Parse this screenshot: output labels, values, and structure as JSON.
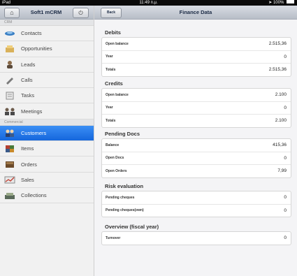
{
  "status": {
    "device": "iPad",
    "time": "11:49 п.μ.",
    "battery": "100%"
  },
  "sidebar": {
    "title": "Soft1 mCRM",
    "home_icon": "home-icon",
    "power_icon": "power-icon",
    "sections": [
      {
        "label": "CRM",
        "items": [
          {
            "label": "Contacts",
            "icon": "contacts-icon"
          },
          {
            "label": "Opportunities",
            "icon": "opportunities-icon"
          },
          {
            "label": "Leads",
            "icon": "leads-icon"
          },
          {
            "label": "Calls",
            "icon": "calls-icon"
          },
          {
            "label": "Tasks",
            "icon": "tasks-icon"
          },
          {
            "label": "Meetings",
            "icon": "meetings-icon"
          }
        ]
      },
      {
        "label": "Commercial",
        "items": [
          {
            "label": "Customers",
            "icon": "customers-icon",
            "active": true
          },
          {
            "label": "Items",
            "icon": "items-icon"
          },
          {
            "label": "Orders",
            "icon": "orders-icon"
          },
          {
            "label": "Sales",
            "icon": "sales-icon"
          },
          {
            "label": "Collections",
            "icon": "collections-icon"
          }
        ]
      }
    ]
  },
  "header": {
    "back_label": "Back",
    "title": "Finance Data"
  },
  "groups": [
    {
      "title": "Debits",
      "rows": [
        {
          "label": "Open balance",
          "value": "2.515,36"
        },
        {
          "label": "Year",
          "value": "0"
        },
        {
          "label": "Totals",
          "value": "2.515,36"
        }
      ]
    },
    {
      "title": "Credits",
      "rows": [
        {
          "label": "Open balance",
          "value": "2.100"
        },
        {
          "label": "Year",
          "value": "0"
        },
        {
          "label": "Totals",
          "value": "2.100"
        }
      ]
    },
    {
      "title": "Pending Docs",
      "rows": [
        {
          "label": "Balance",
          "value": "415,36"
        },
        {
          "label": "Open Docs",
          "value": "0"
        },
        {
          "label": "Open Orders",
          "value": "7,99"
        }
      ]
    },
    {
      "title": "Risk evaluation",
      "rows": [
        {
          "label": "Pending cheques",
          "value": "0"
        },
        {
          "label": "Pending cheques(own)",
          "value": "0"
        }
      ]
    },
    {
      "title": "Overview (fiscal year)",
      "rows": [
        {
          "label": "Turnover",
          "value": "0"
        }
      ]
    }
  ]
}
